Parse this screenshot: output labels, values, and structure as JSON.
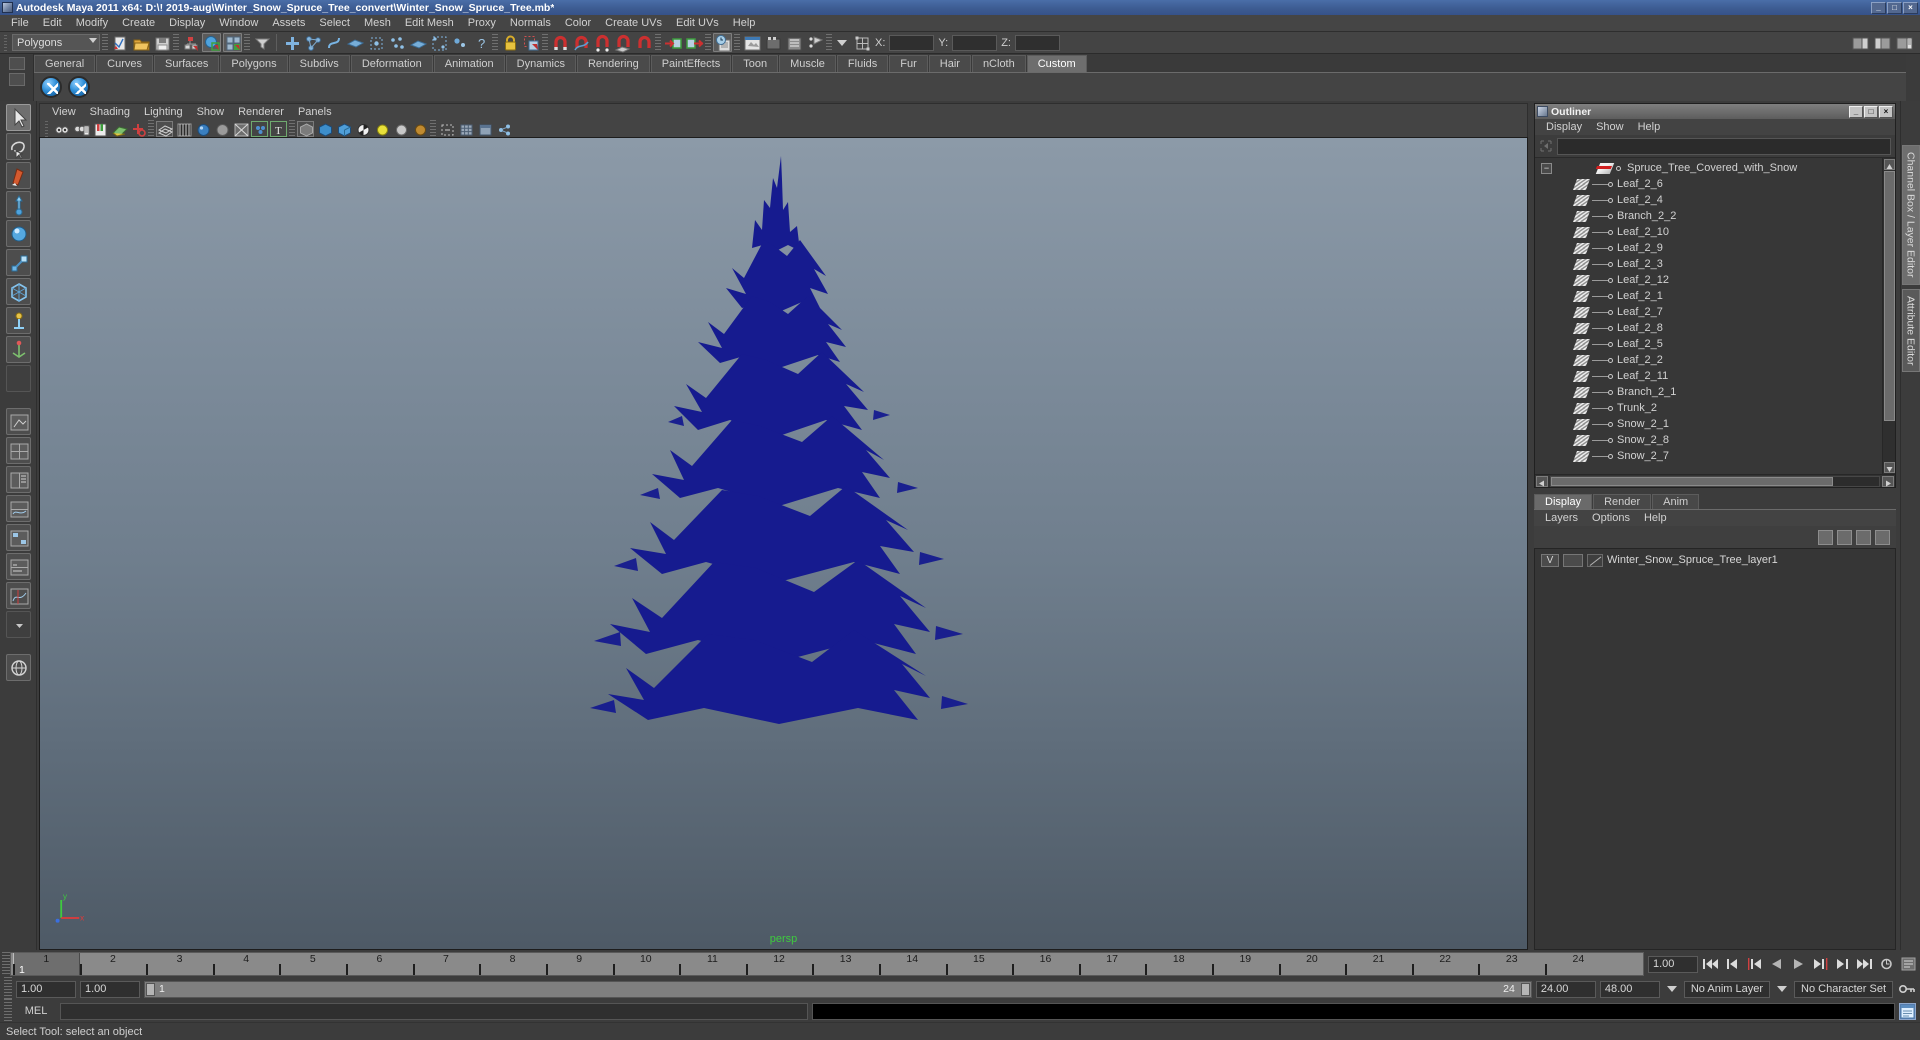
{
  "window": {
    "title": "Autodesk Maya 2011 x64: D:\\! 2019-aug\\Winter_Snow_Spruce_Tree_convert\\Winter_Snow_Spruce_Tree.mb*",
    "minimize": "_",
    "maximize": "□",
    "close": "×"
  },
  "main_menu": [
    "File",
    "Edit",
    "Modify",
    "Create",
    "Display",
    "Window",
    "Assets",
    "Select",
    "Mesh",
    "Edit Mesh",
    "Proxy",
    "Normals",
    "Color",
    "Create UVs",
    "Edit UVs",
    "Help"
  ],
  "status_line": {
    "mode_selector": "Polygons",
    "coord_labels": [
      "X:",
      "Y:",
      "Z:"
    ],
    "coord_values": [
      "",
      "",
      ""
    ]
  },
  "shelf": {
    "tabs": [
      "General",
      "Curves",
      "Surfaces",
      "Polygons",
      "Subdivs",
      "Deformation",
      "Animation",
      "Dynamics",
      "Rendering",
      "PaintEffects",
      "Toon",
      "Muscle",
      "Fluids",
      "Fur",
      "Hair",
      "nCloth",
      "Custom"
    ],
    "active_tab": "Custom"
  },
  "viewport": {
    "menu": [
      "View",
      "Shading",
      "Lighting",
      "Show",
      "Renderer",
      "Panels"
    ],
    "camera_label": "persp",
    "axis": {
      "y": "y",
      "x": "x",
      "z": "z"
    }
  },
  "outliner": {
    "title": "Outliner",
    "menu": [
      "Display",
      "Show",
      "Help"
    ],
    "search_value": "",
    "items": [
      {
        "label": "Spruce_Tree_Covered_with_Snow",
        "type": "root",
        "expanded": true
      },
      {
        "label": "Leaf_2_6",
        "type": "mesh"
      },
      {
        "label": "Leaf_2_4",
        "type": "mesh"
      },
      {
        "label": "Branch_2_2",
        "type": "mesh"
      },
      {
        "label": "Leaf_2_10",
        "type": "mesh"
      },
      {
        "label": "Leaf_2_9",
        "type": "mesh"
      },
      {
        "label": "Leaf_2_3",
        "type": "mesh"
      },
      {
        "label": "Leaf_2_12",
        "type": "mesh"
      },
      {
        "label": "Leaf_2_1",
        "type": "mesh"
      },
      {
        "label": "Leaf_2_7",
        "type": "mesh"
      },
      {
        "label": "Leaf_2_8",
        "type": "mesh"
      },
      {
        "label": "Leaf_2_5",
        "type": "mesh"
      },
      {
        "label": "Leaf_2_2",
        "type": "mesh"
      },
      {
        "label": "Leaf_2_11",
        "type": "mesh"
      },
      {
        "label": "Branch_2_1",
        "type": "mesh"
      },
      {
        "label": "Trunk_2",
        "type": "mesh"
      },
      {
        "label": "Snow_2_1",
        "type": "mesh"
      },
      {
        "label": "Snow_2_8",
        "type": "mesh"
      },
      {
        "label": "Snow_2_7",
        "type": "mesh"
      }
    ]
  },
  "layer_editor": {
    "tabs": [
      "Display",
      "Render",
      "Anim"
    ],
    "active_tab": "Display",
    "menu": [
      "Layers",
      "Options",
      "Help"
    ],
    "layers": [
      {
        "visibility": "V",
        "display_type": "",
        "name": "Winter_Snow_Spruce_Tree_layer1"
      }
    ]
  },
  "dock_tabs": [
    "Channel Box / Layer Editor",
    "Attribute Editor"
  ],
  "time_slider": {
    "ticks": [
      1,
      2,
      3,
      4,
      5,
      6,
      7,
      8,
      9,
      10,
      11,
      12,
      13,
      14,
      15,
      16,
      17,
      18,
      19,
      20,
      21,
      22,
      23,
      24
    ],
    "current_frame": "1",
    "current_frame_field": "1.00"
  },
  "range_slider": {
    "start": "1.00",
    "range_start": "1.00",
    "range_bar_start": "1",
    "range_bar_end": "24",
    "end": "24.00",
    "playback_end": "48.00",
    "anim_layer": "No Anim Layer",
    "character_set": "No Character Set"
  },
  "command_line": {
    "label": "MEL",
    "input_value": "",
    "output_value": ""
  },
  "help_line": {
    "text": "Select Tool: select an object"
  },
  "colors": {
    "titlebar": "#3d5c92",
    "tree_model": "#161b8f",
    "viewport_top": "#8c9aa8",
    "viewport_bottom": "#4e5a66",
    "persp_label": "#3ecb3e",
    "accent_red": "#d02020"
  }
}
